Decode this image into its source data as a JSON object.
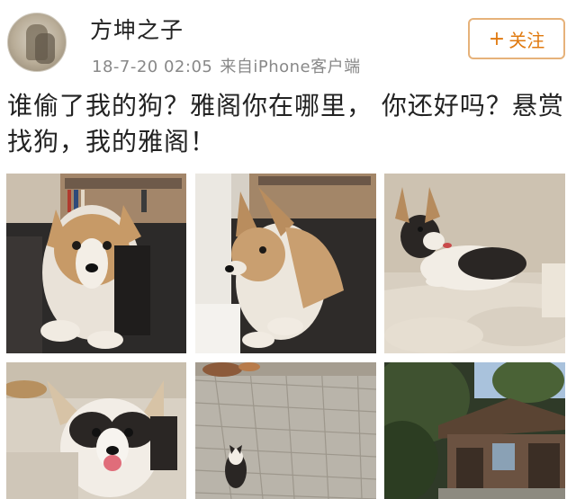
{
  "post": {
    "author": {
      "name": "方坤之子",
      "avatar": "avatar-image"
    },
    "timestamp": "18-7-20 02:05",
    "source": "来自iPhone客户端",
    "follow_button": {
      "icon": "plus-icon",
      "label": "关注",
      "plus": "+"
    },
    "text": "谁偷了我的狗？雅阁你在哪里， 你还好吗？悬赏找狗，我的雅阁！",
    "photos": [
      {
        "subject": "corgi-on-sofa-front"
      },
      {
        "subject": "corgi-on-sofa-side"
      },
      {
        "subject": "corgi-lying-on-cushion"
      },
      {
        "subject": "corgi-puppy-closeup"
      },
      {
        "subject": "stone-pavement-with-corgi"
      },
      {
        "subject": "garden-house"
      }
    ]
  },
  "colors": {
    "follow_accent": "#e07a10",
    "follow_border": "#e6b27a",
    "meta_text": "#888888"
  }
}
